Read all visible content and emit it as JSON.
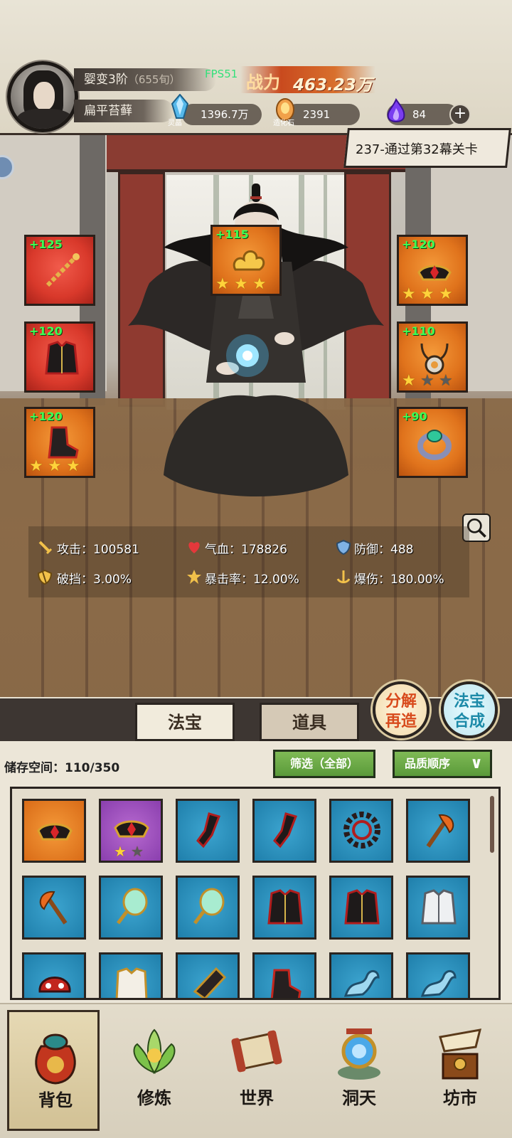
{
  "header": {
    "realm": "婴变3阶",
    "realm_sub": "（655旬）",
    "player_name": "扁平苔藓",
    "fps": "FPS51",
    "power_label": "战力",
    "power_value": "463.23万",
    "resources": [
      {
        "label": "灵晶",
        "value": "1396.7万",
        "icon": "blue-crystal-icon"
      },
      {
        "label": "造化石",
        "value": "2391",
        "icon": "gold-stone-icon"
      },
      {
        "label": "",
        "value": "84",
        "icon": "purple-flame-icon"
      }
    ]
  },
  "stage": {
    "text": "237-通过第32幕关卡"
  },
  "equipment": [
    {
      "plus": "+125",
      "stars": 0,
      "max_stars": 0,
      "color": "red",
      "icon": "chain-whip-icon"
    },
    {
      "plus": "+115",
      "stars": 3,
      "max_stars": 3,
      "color": "orange",
      "icon": "golden-cloud-icon"
    },
    {
      "plus": "+120",
      "stars": 3,
      "max_stars": 3,
      "color": "orange",
      "icon": "crown-icon"
    },
    {
      "plus": "+120",
      "stars": 0,
      "max_stars": 0,
      "color": "red",
      "icon": "robe-icon"
    },
    {
      "plus": "+110",
      "stars": 1,
      "max_stars": 3,
      "color": "orange",
      "icon": "jade-necklace-icon"
    },
    {
      "plus": "+120",
      "stars": 3,
      "max_stars": 3,
      "color": "red",
      "icon": "boots-icon"
    },
    {
      "plus": "+90",
      "stars": 0,
      "max_stars": 0,
      "color": "orange",
      "icon": "jade-ring-icon"
    }
  ],
  "stats": {
    "attack": "攻击：100581",
    "hp": "气血：178826",
    "defense": "防御：488",
    "break_block": "破挡：3.00%",
    "crit_rate": "暴击率：12.00%",
    "crit_damage": "爆伤：180.00%"
  },
  "buttons": {
    "decompose": [
      "分解",
      "再造"
    ],
    "merge": [
      "法宝",
      "合成"
    ]
  },
  "tabs": {
    "treasure": "法宝",
    "items": "道具"
  },
  "inventory": {
    "storage": "储存空间：110/350",
    "filter": "筛选（全部）",
    "sort": "品质顺序",
    "sort_arrow": "∨",
    "items": [
      {
        "color": "orange",
        "icon": "crown-icon",
        "stars": 0
      },
      {
        "color": "purple",
        "icon": "crown-icon",
        "stars": 1,
        "max_stars": 2
      },
      {
        "color": "blue",
        "icon": "boots-icon",
        "stars": 0
      },
      {
        "color": "blue",
        "icon": "boots-icon",
        "stars": 0
      },
      {
        "color": "blue",
        "icon": "saw-ring-icon",
        "stars": 0
      },
      {
        "color": "blue",
        "icon": "axe-icon",
        "stars": 0
      },
      {
        "color": "blue",
        "icon": "axe-icon",
        "stars": 0
      },
      {
        "color": "blue",
        "icon": "mirror-icon",
        "stars": 0
      },
      {
        "color": "blue",
        "icon": "mirror-icon",
        "stars": 0
      },
      {
        "color": "blue",
        "icon": "robe-icon",
        "stars": 0
      },
      {
        "color": "blue",
        "icon": "robe-icon",
        "stars": 0
      },
      {
        "color": "blue",
        "icon": "white-armor-icon",
        "stars": 0
      },
      {
        "color": "blue",
        "icon": "demon-helm-icon",
        "stars": 0
      },
      {
        "color": "blue",
        "icon": "gold-armor-icon",
        "stars": 0
      },
      {
        "color": "blue",
        "icon": "gauntlet-icon",
        "stars": 0
      },
      {
        "color": "blue",
        "icon": "boots-icon",
        "stars": 0
      },
      {
        "color": "blue",
        "icon": "blue-dragon-icon",
        "stars": 0
      },
      {
        "color": "blue",
        "icon": "blue-dragon-icon",
        "stars": 0
      }
    ]
  },
  "nav": [
    {
      "label": "背包",
      "icon": "bag-icon",
      "active": true
    },
    {
      "label": "修炼",
      "icon": "lotus-icon",
      "active": false
    },
    {
      "label": "世界",
      "icon": "scroll-map-icon",
      "active": false
    },
    {
      "label": "洞天",
      "icon": "portal-icon",
      "active": false
    },
    {
      "label": "坊市",
      "icon": "market-icon",
      "active": false
    }
  ]
}
